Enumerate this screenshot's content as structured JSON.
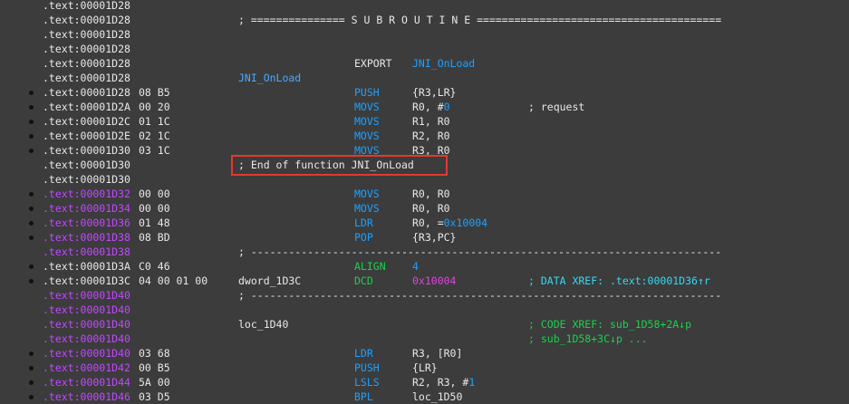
{
  "lines": [
    {
      "addr": ".text:00001D28",
      "purple": false,
      "dot": false
    },
    {
      "addr": ".text:00001D28",
      "purple": false,
      "dot": false,
      "label": "; =============== S U B R O U T I N E =======================================",
      "label_class": "sep"
    },
    {
      "addr": ".text:00001D28",
      "purple": false,
      "dot": false
    },
    {
      "addr": ".text:00001D28",
      "purple": false,
      "dot": false
    },
    {
      "addr": ".text:00001D28",
      "purple": false,
      "dot": false,
      "mnem": "EXPORT",
      "mnem_class": "export",
      "ops": "JNI_OnLoad",
      "ops_class": "sym"
    },
    {
      "addr": ".text:00001D28",
      "purple": false,
      "dot": false,
      "label": "JNI_OnLoad",
      "label_class": "blue"
    },
    {
      "addr": ".text:00001D28",
      "purple": false,
      "dot": true,
      "bytes": "08 B5",
      "mnem": "PUSH",
      "ops": "{R3,LR}"
    },
    {
      "addr": ".text:00001D2A",
      "purple": false,
      "dot": true,
      "bytes": "00 20",
      "mnem": "MOVS",
      "ops_parts": [
        "R0, #",
        "0"
      ],
      "comment": "; request"
    },
    {
      "addr": ".text:00001D2C",
      "purple": false,
      "dot": true,
      "bytes": "01 1C",
      "mnem": "MOVS",
      "ops": "R1, R0"
    },
    {
      "addr": ".text:00001D2E",
      "purple": false,
      "dot": true,
      "bytes": "02 1C",
      "mnem": "MOVS",
      "ops": "R2, R0"
    },
    {
      "addr": ".text:00001D30",
      "purple": false,
      "dot": true,
      "bytes": "03 1C",
      "mnem": "MOVS",
      "ops": "R3, R0"
    },
    {
      "addr": ".text:00001D30",
      "purple": false,
      "dot": false,
      "label": "; End of function JNI_OnLoad",
      "label_class": "sep"
    },
    {
      "addr": ".text:00001D30",
      "purple": false,
      "dot": false
    },
    {
      "addr": ".text:00001D32",
      "purple": true,
      "dot": true,
      "bytes": "00 00",
      "mnem": "MOVS",
      "ops": "R0, R0"
    },
    {
      "addr": ".text:00001D34",
      "purple": true,
      "dot": true,
      "bytes": "00 00",
      "mnem": "MOVS",
      "ops": "R0, R0"
    },
    {
      "addr": ".text:00001D36",
      "purple": true,
      "dot": true,
      "bytes": "01 48",
      "mnem": "LDR",
      "ops_parts": [
        "R0, =",
        "0x10004"
      ]
    },
    {
      "addr": ".text:00001D38",
      "purple": true,
      "dot": true,
      "bytes": "08 BD",
      "mnem": "POP",
      "ops": "{R3,PC}"
    },
    {
      "addr": ".text:00001D38",
      "purple": true,
      "dot": false,
      "label": "; ---------------------------------------------------------------------------",
      "label_class": "sep"
    },
    {
      "addr": ".text:00001D3A",
      "purple": false,
      "dot": true,
      "bytes": "C0 46",
      "mnem": "ALIGN",
      "mnem_class": "green",
      "ops": "4",
      "ops_class": "num"
    },
    {
      "addr": ".text:00001D3C",
      "purple": false,
      "dot": true,
      "bytes": "04 00 01 00",
      "label": "dword_1D3C",
      "label_class": "sep",
      "mnem": "DCD",
      "mnem_class": "green",
      "ops": "0x10004",
      "ops_class": "pink",
      "comment_parts": [
        "; DATA XREF: .text:00001D36",
        "↑",
        "r"
      ],
      "comment_class": "cyan"
    },
    {
      "addr": ".text:00001D40",
      "purple": true,
      "dot": false,
      "label": "; ---------------------------------------------------------------------------",
      "label_class": "sep"
    },
    {
      "addr": ".text:00001D40",
      "purple": true,
      "dot": false
    },
    {
      "addr": ".text:00001D40",
      "purple": true,
      "dot": false,
      "label": "loc_1D40",
      "label_class": "sep",
      "comment_parts": [
        "; CODE XREF: sub_1D58+2A",
        "↓",
        "p"
      ],
      "comment_class": "green"
    },
    {
      "addr": ".text:00001D40",
      "purple": true,
      "dot": false,
      "comment_parts": [
        "; sub_1D58+3C",
        "↓",
        "p ..."
      ],
      "comment_class": "green"
    },
    {
      "addr": ".text:00001D40",
      "purple": true,
      "dot": true,
      "bytes": "03 68",
      "mnem": "LDR",
      "ops": "R3, [R0]"
    },
    {
      "addr": ".text:00001D42",
      "purple": true,
      "dot": true,
      "bytes": "00 B5",
      "mnem": "PUSH",
      "ops": "{LR}"
    },
    {
      "addr": ".text:00001D44",
      "purple": true,
      "dot": true,
      "bytes": "5A 00",
      "mnem": "LSLS",
      "ops_parts": [
        "R2, R3, #",
        "1"
      ]
    },
    {
      "addr": ".text:00001D46",
      "purple": true,
      "dot": true,
      "bytes": "03 D5",
      "mnem": "BPL",
      "ops": "loc_1D50"
    }
  ]
}
